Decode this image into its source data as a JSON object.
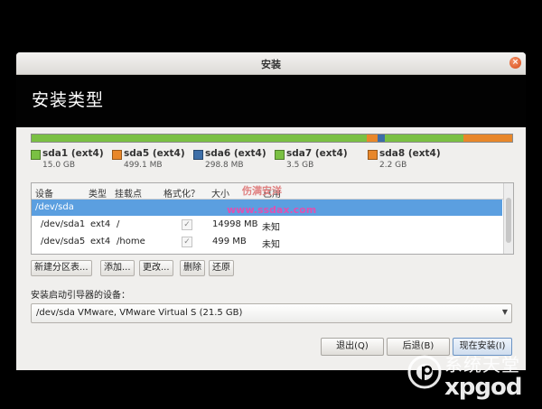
{
  "window": {
    "title": "安装",
    "heading": "安装类型",
    "close_glyph": "×"
  },
  "partitions": [
    {
      "name": "sda1 (ext4)",
      "size": "15.0 GB",
      "color": "#7ac043"
    },
    {
      "name": "sda5 (ext4)",
      "size": "499.1 MB",
      "color": "#e8872a"
    },
    {
      "name": "sda6 (ext4)",
      "size": "298.8 MB",
      "color": "#3d6ea8"
    },
    {
      "name": "sda7 (ext4)",
      "size": "3.5 GB",
      "color": "#7ac043"
    },
    {
      "name": "sda8 (ext4)",
      "size": "2.2 GB",
      "color": "#e8872a"
    }
  ],
  "table": {
    "headers": [
      "设备",
      "类型",
      "挂载点",
      "格式化？",
      "大小",
      "已用"
    ],
    "disk_row": {
      "device": "/dev/sda"
    },
    "rows": [
      {
        "device": "/dev/sda1",
        "type": "ext4",
        "mount": "/",
        "format": "✓",
        "size": "14998 MB",
        "used": "未知"
      },
      {
        "device": "/dev/sda5",
        "type": "ext4",
        "mount": "/home",
        "format": "✓",
        "size": "499 MB",
        "used": "未知"
      }
    ]
  },
  "watermark": {
    "cn": "伤满安洋",
    "url": "www.ssdax.com"
  },
  "partition_buttons": {
    "new_table": "新建分区表...",
    "add": "添加...",
    "change": "更改...",
    "delete": "删除",
    "revert": "还原"
  },
  "boot_loader": {
    "label": "安装启动引导器的设备：",
    "value": "/dev/sda   VMware, VMware Virtual S (21.5 GB)"
  },
  "dialog_buttons": {
    "quit": "退出(Q)",
    "back": "后退(B)",
    "install_now": "现在安装(I)"
  },
  "site_logo": {
    "cn": "系统天堂",
    "en": "xpgod"
  }
}
